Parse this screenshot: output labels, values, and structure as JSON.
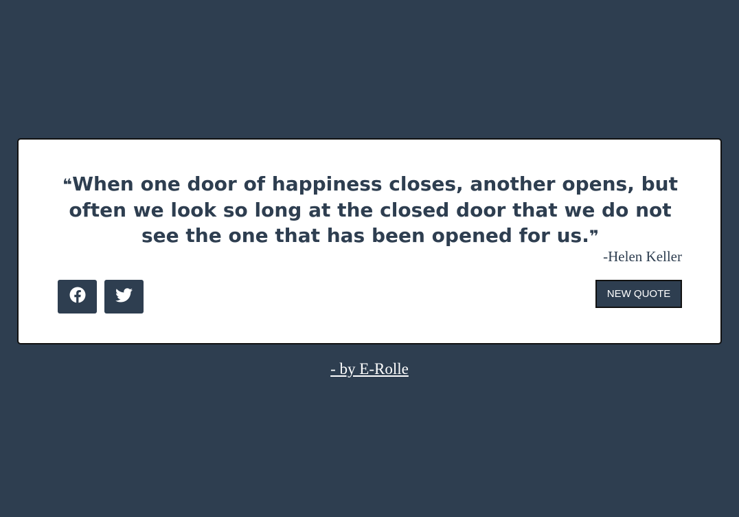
{
  "quote": {
    "open_mark": "❝",
    "text": "When one door of happiness closes, another opens, but often we look so long at the closed door that we do not see the one that has been opened for us.",
    "close_mark": "❞",
    "author": "-Helen Keller"
  },
  "buttons": {
    "new_quote_label": "NEW QUOTE",
    "facebook_icon": "facebook-icon",
    "twitter_icon": "twitter-icon"
  },
  "footer": {
    "credit_label": "- by E-Rolle"
  },
  "colors": {
    "background": "#2e3e50",
    "card": "#ffffff",
    "accent": "#2e3e50"
  }
}
